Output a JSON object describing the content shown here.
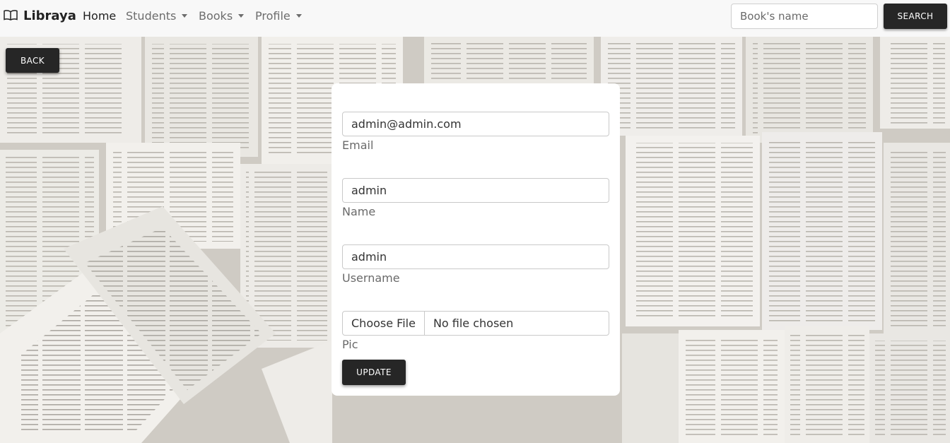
{
  "navbar": {
    "brand": "Libraya",
    "brand_icon": "open-book-icon",
    "items": [
      {
        "label": "Home",
        "active": true,
        "dropdown": false
      },
      {
        "label": "Students",
        "active": false,
        "dropdown": true
      },
      {
        "label": "Books",
        "active": false,
        "dropdown": true
      },
      {
        "label": "Profile",
        "active": false,
        "dropdown": true
      }
    ],
    "search": {
      "placeholder": "Book's name",
      "button_label": "SEARCH"
    }
  },
  "back_label": "BACK",
  "form": {
    "email": {
      "value": "admin@admin.com",
      "label": "Email"
    },
    "name": {
      "value": "admin",
      "label": "Name"
    },
    "username": {
      "value": "admin",
      "label": "Username"
    },
    "pic": {
      "button": "Choose File",
      "status": "No file chosen",
      "label": "Pic"
    },
    "submit_label": "UPDATE"
  },
  "colors": {
    "button_dark": "#262626",
    "navbar_bg": "#f8f8f8",
    "card_bg": "#ffffff"
  }
}
